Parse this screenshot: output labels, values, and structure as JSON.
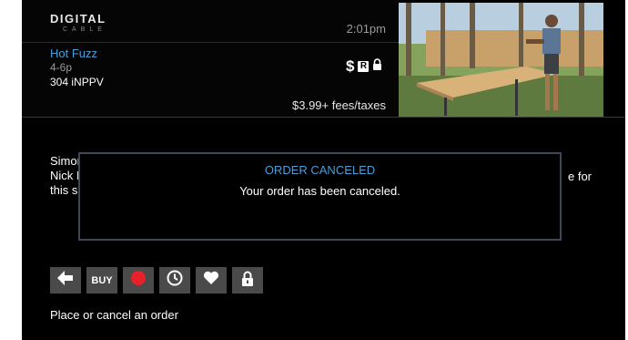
{
  "brand": {
    "logo_top": "DIGITAL",
    "logo_bottom": "CABLE"
  },
  "header": {
    "time": "2:01pm",
    "program_title": "Hot Fuzz",
    "program_time": "4-6p",
    "channel": "304 iNPPV",
    "price_symbol": "$",
    "rating": "R",
    "price_text": "$3.99+ fees/taxes"
  },
  "description": {
    "line1": "Simor",
    "line2": "Nick I",
    "line3": "this s",
    "right_fragment": "e for"
  },
  "dialog": {
    "title": "ORDER CANCELED",
    "message": "Your order has been canceled."
  },
  "actions": {
    "buy_label": "BUY",
    "hint": "Place or cancel an order"
  },
  "colors": {
    "accent": "#4a9ed8",
    "record": "#e8202a",
    "button_bg": "#4a4a4a"
  },
  "icons": [
    "back-arrow-icon",
    "record-icon",
    "clock-icon",
    "heart-icon",
    "lock-icon"
  ]
}
